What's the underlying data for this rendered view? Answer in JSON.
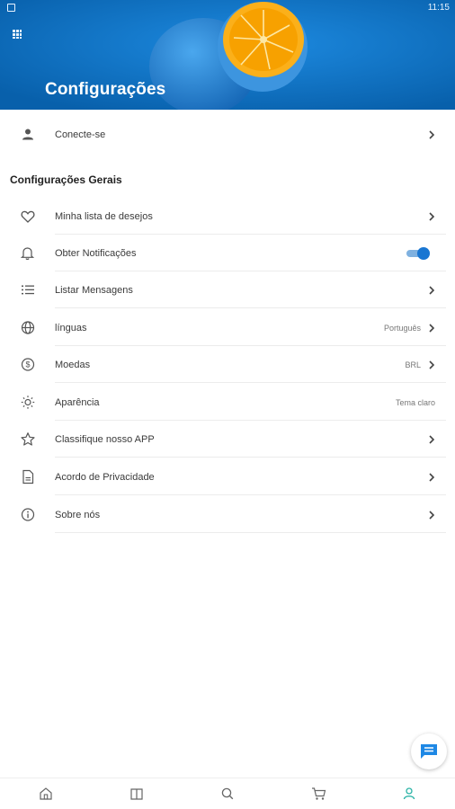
{
  "status_bar": {
    "time": "11:15"
  },
  "header": {
    "title": "Configurações"
  },
  "account": {
    "login_label": "Conecte-se"
  },
  "general_settings": {
    "title": "Configurações Gerais",
    "items": [
      {
        "label": "Minha lista de desejos",
        "icon": "heart-icon"
      },
      {
        "label": "Obter Notificações",
        "icon": "bell-icon",
        "toggle_on": true
      },
      {
        "label": "Listar Mensagens",
        "icon": "list-icon"
      },
      {
        "label": "línguas",
        "value": "Português",
        "icon": "globe-icon"
      },
      {
        "label": "Moedas",
        "value": "BRL",
        "icon": "currency-icon"
      },
      {
        "label": "Aparência",
        "value": "Tema claro",
        "icon": "sun-icon"
      },
      {
        "label": "Classifique nosso APP",
        "icon": "star-icon"
      },
      {
        "label": "Acordo de Privacidade",
        "icon": "document-icon"
      },
      {
        "label": "Sobre nós",
        "icon": "info-icon"
      }
    ]
  },
  "bottom_nav": [
    "home-icon",
    "book-icon",
    "search-icon",
    "cart-icon",
    "person-icon"
  ],
  "colors": {
    "header_bg": "#0b6fc2",
    "accent": "#1976d2",
    "active_nav": "#2ab3a6",
    "chat_fab": "#1e88e5"
  }
}
